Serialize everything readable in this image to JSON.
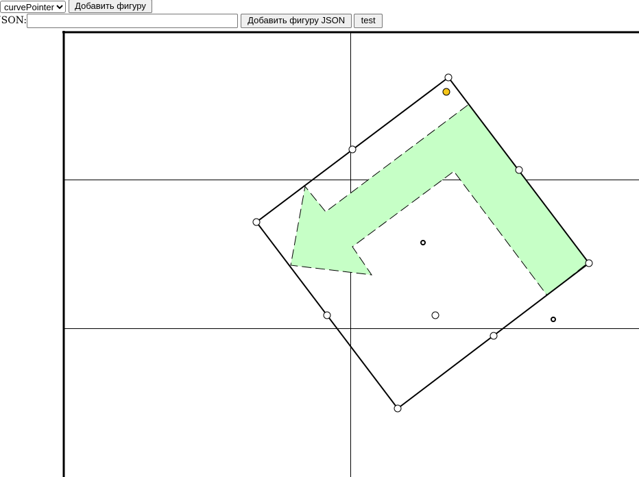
{
  "toolbar": {
    "shape_select_value": "curvePointer",
    "add_shape_label": "Добавить фигуру"
  },
  "json_bar": {
    "label": "JSON:",
    "input_value": "",
    "add_json_label": "Добавить фигуру JSON",
    "test_label": "test"
  },
  "canvas": {
    "shape_fill": "#c6ffc6",
    "selected_handle_color": "#f5c518",
    "handle_fill": "#ffffff",
    "stroke": "#000000"
  }
}
